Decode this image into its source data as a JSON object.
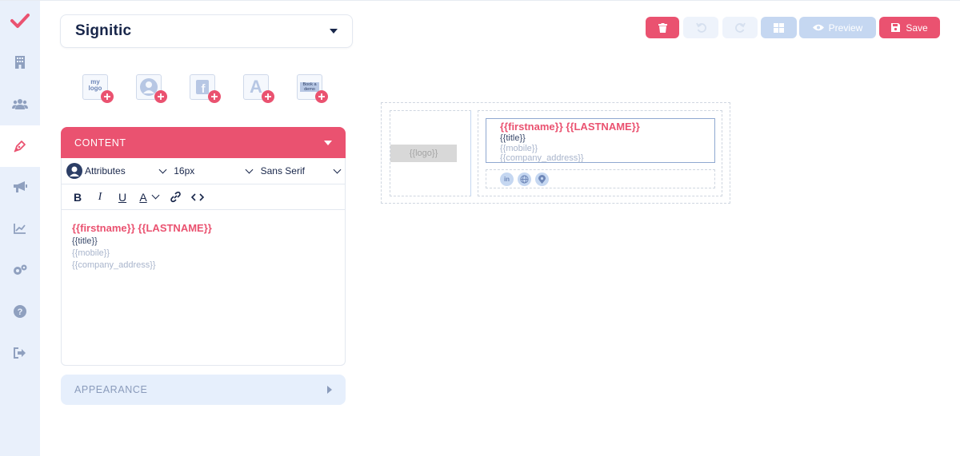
{
  "app": {
    "company": "Signitic"
  },
  "sidebar": {
    "items": [
      {
        "icon": "check-logo-icon"
      },
      {
        "icon": "building-icon"
      },
      {
        "icon": "users-icon"
      },
      {
        "icon": "pen-icon",
        "active": true
      },
      {
        "icon": "megaphone-icon"
      },
      {
        "icon": "chart-icon"
      },
      {
        "icon": "cogs-icon"
      },
      {
        "icon": "help-icon"
      },
      {
        "icon": "logout-icon"
      }
    ]
  },
  "palette": {
    "items": [
      {
        "label": "my logo",
        "icon": "logo-block-icon"
      },
      {
        "label": "",
        "icon": "avatar-block-icon"
      },
      {
        "label": "",
        "icon": "social-block-icon"
      },
      {
        "label": "A",
        "icon": "text-block-icon"
      },
      {
        "label": "Book a demo",
        "icon": "banner-block-icon"
      }
    ]
  },
  "content_panel": {
    "title": "CONTENT",
    "toolbar": {
      "attributes_label": "Attributes",
      "font_size": "16px",
      "font_family": "Sans Serif",
      "bold": "B",
      "italic": "I",
      "underline": "U",
      "color": "A"
    },
    "body": {
      "name_line": "{{firstname}} {{LASTNAME}}",
      "title_line": "{{title}}",
      "mobile_line": "{{mobile}}",
      "address_line": "{{company_address}}"
    }
  },
  "appearance_panel": {
    "title": "APPEARANCE"
  },
  "toolbar": {
    "preview_label": "Preview",
    "save_label": "Save"
  },
  "preview": {
    "logo_placeholder": "{{logo}}",
    "name_line": "{{firstname}} {{LASTNAME}}",
    "title_line": "{{title}}",
    "mobile_line": "{{mobile}}",
    "address_line": "{{company_address}}",
    "social": [
      "in",
      "globe",
      "pin"
    ]
  },
  "colors": {
    "accent": "#ea5270",
    "sidebar_bg": "#e9f0fb",
    "text_dark": "#18264a",
    "placeholder": "#a9b5cc"
  }
}
